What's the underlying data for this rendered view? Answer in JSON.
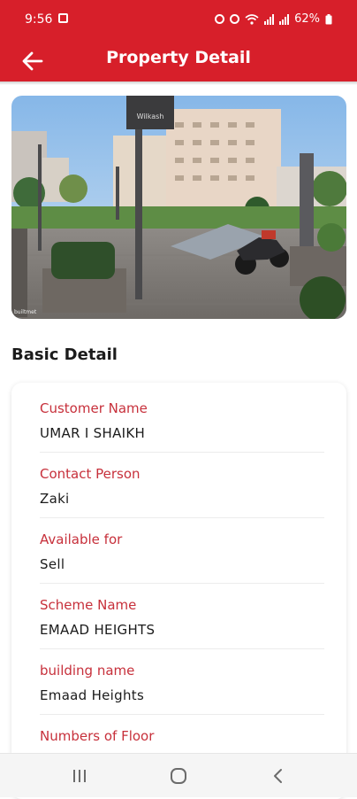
{
  "status": {
    "time": "9:56",
    "battery": "62%"
  },
  "header": {
    "title": "Property Detail"
  },
  "section": {
    "title": "Basic Detail"
  },
  "photo": {
    "sign_text": "Wilkash",
    "watermark": "builtmet"
  },
  "fields": [
    {
      "label": "Customer Name",
      "value": "UMAR I SHAIKH"
    },
    {
      "label": "Contact Person",
      "value": "Zaki"
    },
    {
      "label": "Available for",
      "value": "Sell"
    },
    {
      "label": "Scheme Name",
      "value": "EMAAD HEIGHTS"
    },
    {
      "label": "building name",
      "value": "Emaad Heights"
    },
    {
      "label": "Numbers of Floor",
      "value": ""
    }
  ],
  "colors": {
    "accent": "#d71f2a",
    "label": "#c7303b"
  },
  "icons": {
    "back": "arrow-left-icon",
    "nav_recent": "recent-apps-icon",
    "nav_home": "home-icon",
    "nav_back": "back-chevron-icon"
  }
}
